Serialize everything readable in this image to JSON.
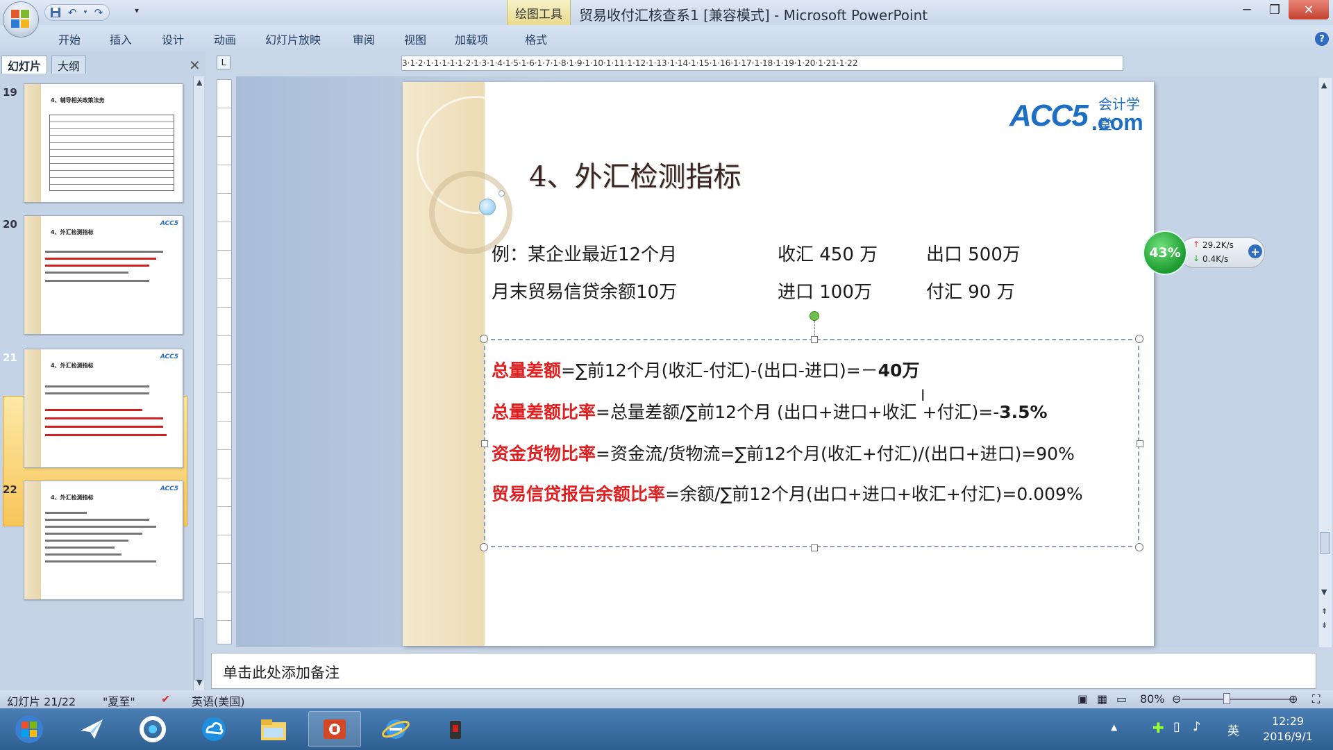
{
  "window": {
    "title": "贸易收付汇核查系1 [兼容模式] - Microsoft PowerPoint",
    "contextual_tab": "绘图工具"
  },
  "ribbon": {
    "tabs": [
      "开始",
      "插入",
      "设计",
      "动画",
      "幻灯片放映",
      "审阅",
      "视图",
      "加载项",
      "格式"
    ]
  },
  "panel": {
    "tab_slides": "幻灯片",
    "tab_outline": "大纲",
    "thumbnails": [
      {
        "number": "19",
        "title": "4、辅导相关政策法务"
      },
      {
        "number": "20",
        "title": "4、外汇检测指标"
      },
      {
        "number": "21",
        "title": "4、外汇检测指标"
      },
      {
        "number": "22",
        "title": "4、外汇检测指标"
      }
    ],
    "selected": "21"
  },
  "ruler": {
    "horizontal": "3·1·2·1·1·1·1·1·2·1·3·1·4·1·5·1·6·1·7·1·8·1·9·1·10·1·11·1·12·1·13·1·14·1·15·1·16·1·17·1·18·1·19·1·20·1·21·1·22"
  },
  "slide": {
    "logo_text": "ACC5",
    "logo_sub": "会计学堂",
    "logo_com": ".com",
    "title": "4、外汇检测指标",
    "example": {
      "line1_left": "例：某企业最近12个月",
      "line1_mid": "收汇  450 万",
      "line1_right": "出口  500万",
      "line2_left": "月末贸易信贷余额10万",
      "line2_mid": "进口  100万",
      "line2_right": "付汇  90  万"
    },
    "formulas": [
      {
        "label": "总量差额",
        "body": "=∑前12个月(收汇-付汇)-(出口-进口)=－",
        "result": "40万"
      },
      {
        "label": "总量差额比率",
        "body": "=总量差额/∑前12个月 (出口+进口+收汇 +付汇)=-",
        "result": "3.5%"
      },
      {
        "label": "资金货物比率",
        "body": "=资金流/货物流=∑前12个月(收汇+付汇)/(出口+进口)=90%",
        "result": ""
      },
      {
        "label": "贸易信贷报告余额比率",
        "body": "=余额/∑前12个月(出口+进口+收汇+付汇)=0.009%",
        "result": ""
      }
    ]
  },
  "netwidget": {
    "percent": "43%",
    "upload": "29.2K/s",
    "download": "0.4K/s"
  },
  "notes": {
    "placeholder": "单击此处添加备注"
  },
  "status": {
    "slide_info": "幻灯片 21/22",
    "theme": "\"夏至\"",
    "language": "英语(美国)",
    "zoom": "80%"
  },
  "taskbar": {
    "tray_lang": "英",
    "time": "12:29",
    "date": "2016/9/1"
  },
  "colors": {
    "formula_label": "#e02020",
    "selected_thumb": "#f7c659",
    "ribbon": "#c8d6ea"
  }
}
